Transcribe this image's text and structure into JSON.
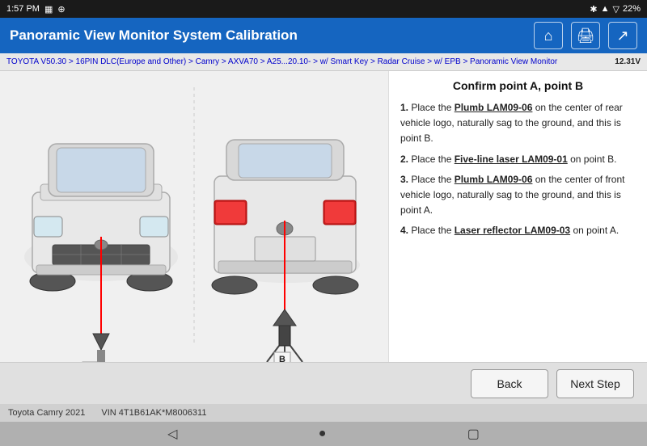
{
  "statusBar": {
    "time": "1:57 PM",
    "batteryIcon": "🔋",
    "batteryPct": "22%",
    "bluetoothIcon": "⚡",
    "wifiIcon": "📶"
  },
  "header": {
    "title": "Panoramic View Monitor System Calibration",
    "homeIcon": "⌂",
    "printIcon": "🖨",
    "exportIcon": "📤"
  },
  "breadcrumb": {
    "text": "TOYOTA V50.30 > 16PIN DLC(Europe and Other) > Camry > AXVA70 > A25...20.10- > w/ Smart Key > Radar Cruise > w/ EPB > Panoramic View Monitor",
    "voltage": "12.31V"
  },
  "instructions": {
    "sectionTitle": "Confirm point A, point B",
    "steps": [
      {
        "num": "1.",
        "prefix": "Place the ",
        "highlight": "Plumb LAM09-06",
        "suffix": " on the center of rear vehicle logo, naturally sag to the ground, and this is point B."
      },
      {
        "num": "2.",
        "prefix": "Place the ",
        "highlight": "Five-line laser LAM09-01",
        "suffix": " on point B."
      },
      {
        "num": "3.",
        "prefix": "Place the ",
        "highlight": "Plumb LAM09-06",
        "suffix": " on the center of front vehicle logo, naturally sag to the ground, and this is point A."
      },
      {
        "num": "4.",
        "prefix": "Place the ",
        "highlight": "Laser reflector LAM09-03",
        "suffix": " on point A."
      }
    ]
  },
  "buttons": {
    "back": "Back",
    "nextStep": "Next Step"
  },
  "footer": {
    "model": "Toyota Camry 2021",
    "vin": "VIN 4T1B61AK*M8006311"
  },
  "bottomNav": {
    "backArrow": "◁",
    "homeCircle": "●",
    "squareBtn": "▢"
  }
}
